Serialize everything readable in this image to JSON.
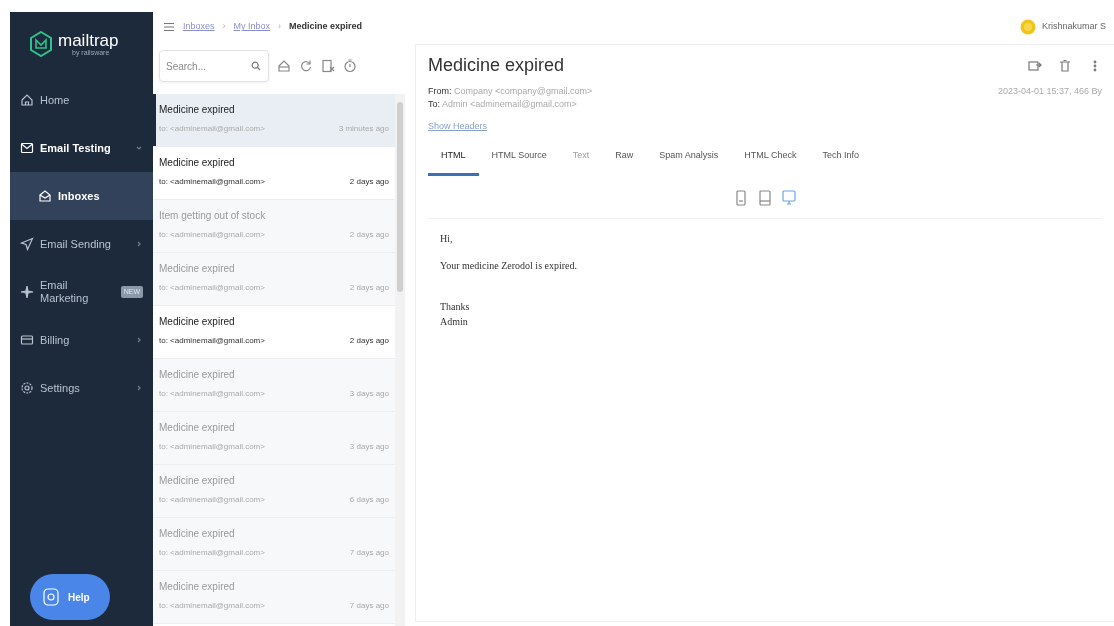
{
  "sidebar": {
    "logo": {
      "name": "mailtrap",
      "tagline": "by railsware"
    },
    "items": [
      {
        "label": "Home",
        "selected": false
      },
      {
        "label": "Email Testing",
        "selected": false,
        "expanded": true,
        "children": [
          {
            "label": "Inboxes",
            "selected": true
          }
        ]
      },
      {
        "label": "Email Sending",
        "selected": false,
        "expanded": false
      },
      {
        "label": "Email Marketing",
        "selected": false,
        "badge": "NEW"
      },
      {
        "label": "Billing",
        "selected": false,
        "expanded": false
      },
      {
        "label": "Settings",
        "selected": false,
        "expanded": false
      }
    ],
    "help": "Help"
  },
  "breadcrumb": {
    "separator": "›",
    "items": [
      "Inboxes",
      "My Inbox",
      "Medicine expired"
    ]
  },
  "user": {
    "name": "Krishnakumar S"
  },
  "search": {
    "placeholder": "Search..."
  },
  "emails": [
    {
      "subject": "Medicine expired",
      "to": "to: <adminemail@gmail.com>",
      "time": "3 minutes ago",
      "unread": true,
      "selected": true
    },
    {
      "subject": "Medicine expired",
      "to": "to: <adminemail@gmail.com>",
      "time": "2 days ago",
      "unread": true,
      "selected": false
    },
    {
      "subject": "Item getting out of stock",
      "to": "to: <adminemail@gmail.com>",
      "time": "2 days ago",
      "unread": false,
      "selected": false
    },
    {
      "subject": "Medicine expired",
      "to": "to: <adminemail@gmail.com>",
      "time": "2 days ago",
      "unread": false,
      "selected": false
    },
    {
      "subject": "Medicine expired",
      "to": "to: <adminemail@gmail.com>",
      "time": "2 days ago",
      "unread": true,
      "selected": false
    },
    {
      "subject": "Medicine expired",
      "to": "to: <adminemail@gmail.com>",
      "time": "3 days ago",
      "unread": false,
      "selected": false
    },
    {
      "subject": "Medicine expired",
      "to": "to: <adminemail@gmail.com>",
      "time": "3 days ago",
      "unread": false,
      "selected": false
    },
    {
      "subject": "Medicine expired",
      "to": "to: <adminemail@gmail.com>",
      "time": "6 days ago",
      "unread": false,
      "selected": false
    },
    {
      "subject": "Medicine expired",
      "to": "to: <adminemail@gmail.com>",
      "time": "7 days ago",
      "unread": false,
      "selected": false
    },
    {
      "subject": "Medicine expired",
      "to": "to: <adminemail@gmail.com>",
      "time": "7 days ago",
      "unread": false,
      "selected": false
    }
  ],
  "message": {
    "subject": "Medicine expired",
    "from_label": "From:",
    "from": "Company <company@gmail.com>",
    "to_label": "To:",
    "to": "Admin <adminemail@gmail.com>",
    "meta": "2023-04-01 15:37, 466 By",
    "show_headers": "Show Headers",
    "tabs": [
      {
        "label": "HTML",
        "selected": true,
        "disabled": false
      },
      {
        "label": "HTML Source",
        "selected": false,
        "disabled": false
      },
      {
        "label": "Text",
        "selected": false,
        "disabled": true
      },
      {
        "label": "Raw",
        "selected": false,
        "disabled": false
      },
      {
        "label": "Spam Analysis",
        "selected": false,
        "disabled": false
      },
      {
        "label": "HTML Check",
        "selected": false,
        "disabled": false
      },
      {
        "label": "Tech Info",
        "selected": false,
        "disabled": false
      }
    ],
    "devices": [
      {
        "kind": "phone",
        "selected": false
      },
      {
        "kind": "tablet",
        "selected": false
      },
      {
        "kind": "desktop",
        "selected": true
      }
    ],
    "body": [
      {
        "lines": [
          "Hi,"
        ]
      },
      {
        "lines": [
          "Your medicine Zerodol is expired."
        ]
      },
      {
        "lines": [
          "Thanks",
          "Admin"
        ]
      }
    ]
  }
}
